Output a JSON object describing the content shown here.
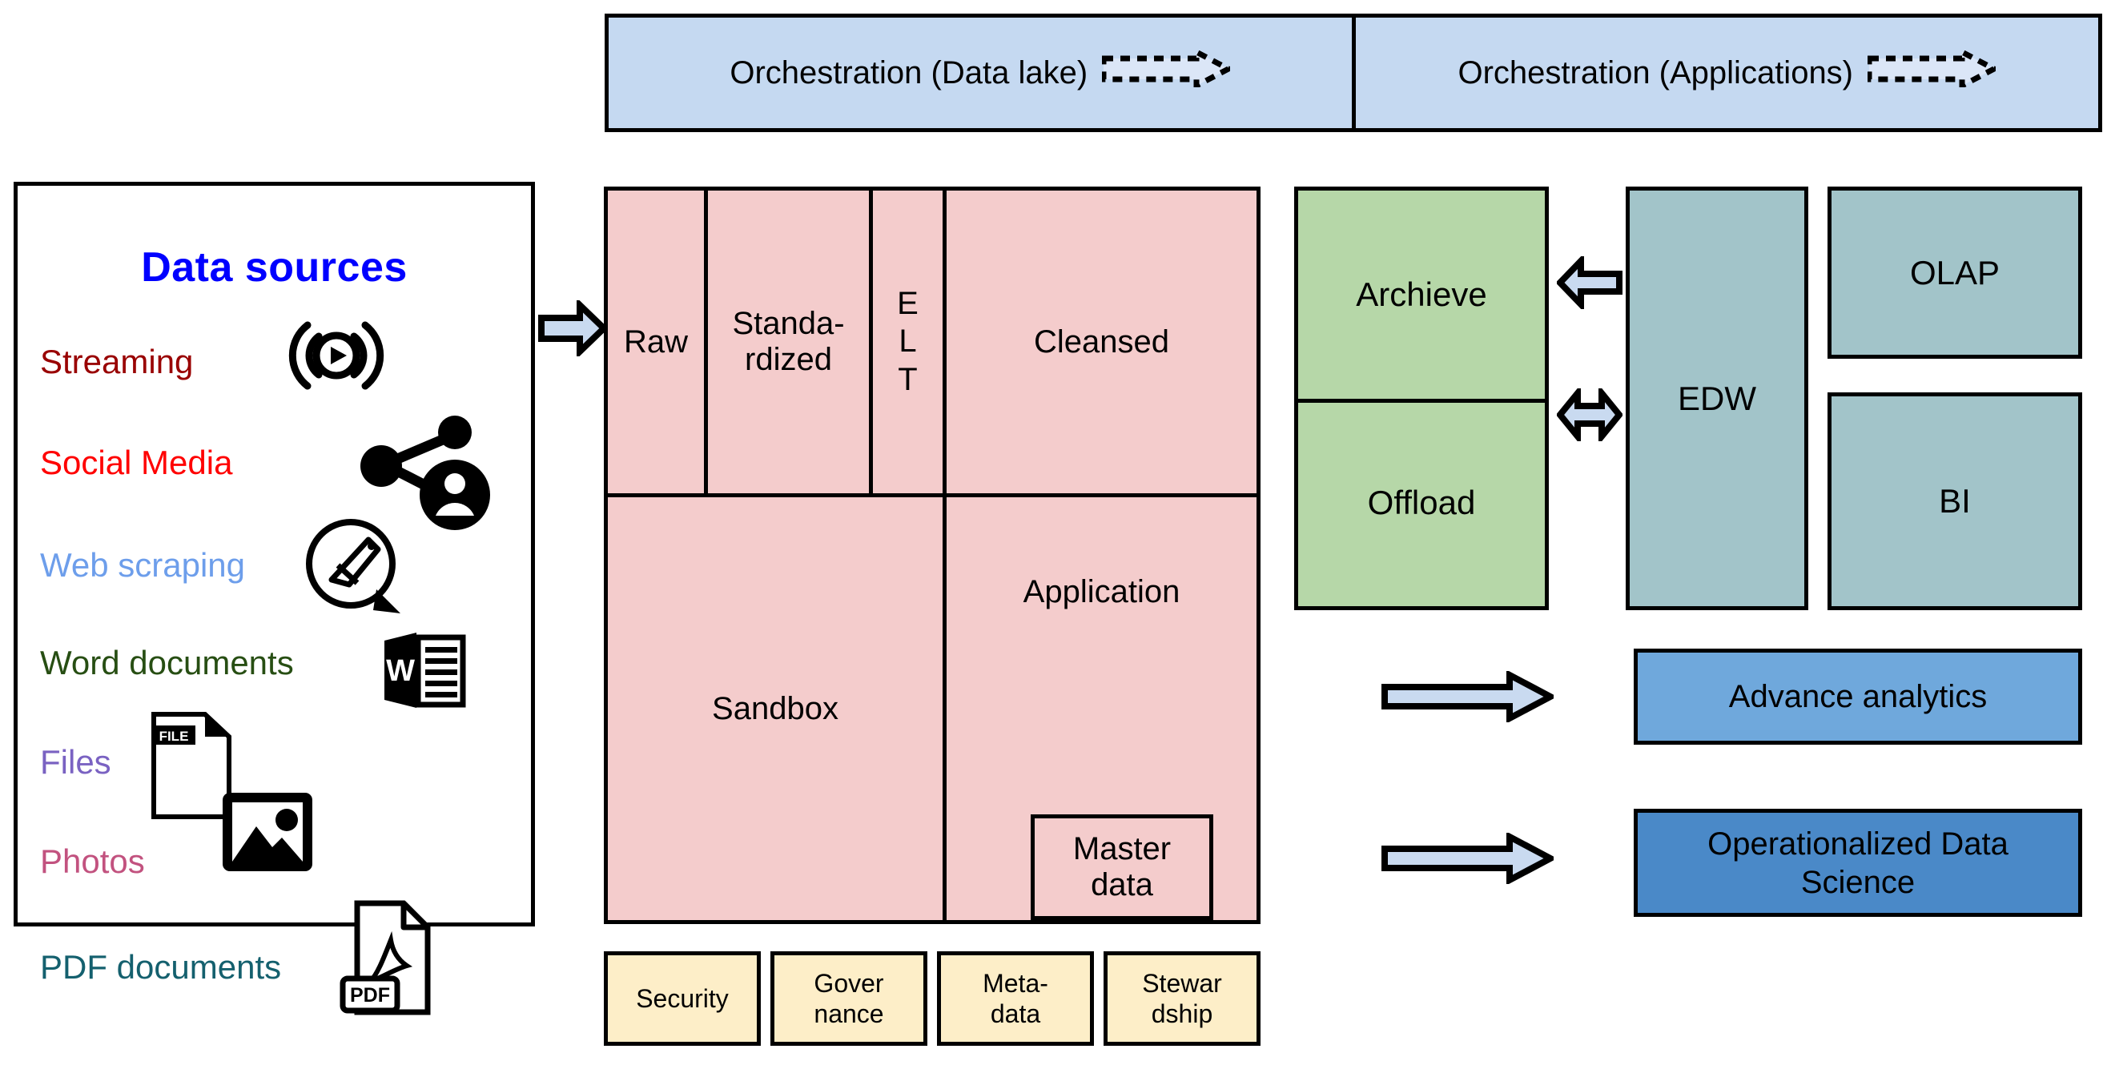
{
  "orchestration": {
    "cells": [
      {
        "label": "Orchestration (Data lake)",
        "icon": "dashed-arrow-icon"
      },
      {
        "label": "Orchestration (Applications)",
        "icon": "dashed-arrow-icon"
      }
    ]
  },
  "data_sources": {
    "title": "Data sources",
    "items": [
      {
        "label": "Streaming",
        "color": "#990000",
        "icon": "broadcast-stream-icon"
      },
      {
        "label": "Social Media",
        "color": "#ff0000",
        "icon": "social-network-icon"
      },
      {
        "label": "Web scraping",
        "color": "#6d9eeb",
        "icon": "scraper-bubble-icon"
      },
      {
        "label": "Word documents",
        "color": "#274e13",
        "icon": "word-document-icon"
      },
      {
        "label": "Files",
        "color": "#7a62c2",
        "icon": "file-icon"
      },
      {
        "label": "Photos",
        "color": "#c2527f",
        "icon": "photo-icon"
      },
      {
        "label": "PDF documents",
        "color": "#14606e",
        "icon": "pdf-document-icon"
      }
    ]
  },
  "data_lake": {
    "top_row": [
      {
        "label": "Raw"
      },
      {
        "label": "Standa-\nrdized"
      },
      {
        "label": "E L T",
        "vertical": true
      },
      {
        "label": "Cleansed"
      }
    ],
    "bottom_row": [
      {
        "label": "Sandbox"
      },
      {
        "label": "Application"
      }
    ],
    "master_data": "Master\ndata"
  },
  "governance": {
    "boxes": [
      "Security",
      "Gover\nnance",
      "Meta-\ndata",
      "Stewar\ndship"
    ]
  },
  "warehouse": {
    "archieve": "Archieve",
    "offload": "Offload",
    "edw": "EDW",
    "olap": "OLAP",
    "bi": "BI"
  },
  "outputs": {
    "advance_analytics": "Advance analytics",
    "operationalized_data_science": "Operationalized Data\nScience"
  },
  "colors": {
    "orchestration_fill": "#c5d9f1",
    "lake_fill": "#f4cccc",
    "governance_fill": "#fdeec8",
    "green_fill": "#b6d7a8",
    "teal_fill": "#a2c4c9",
    "advance_fill": "#6fa8dc",
    "ods_fill": "#4a89c8",
    "arrow_fill": "#c9daf0",
    "stroke": "#000000"
  }
}
